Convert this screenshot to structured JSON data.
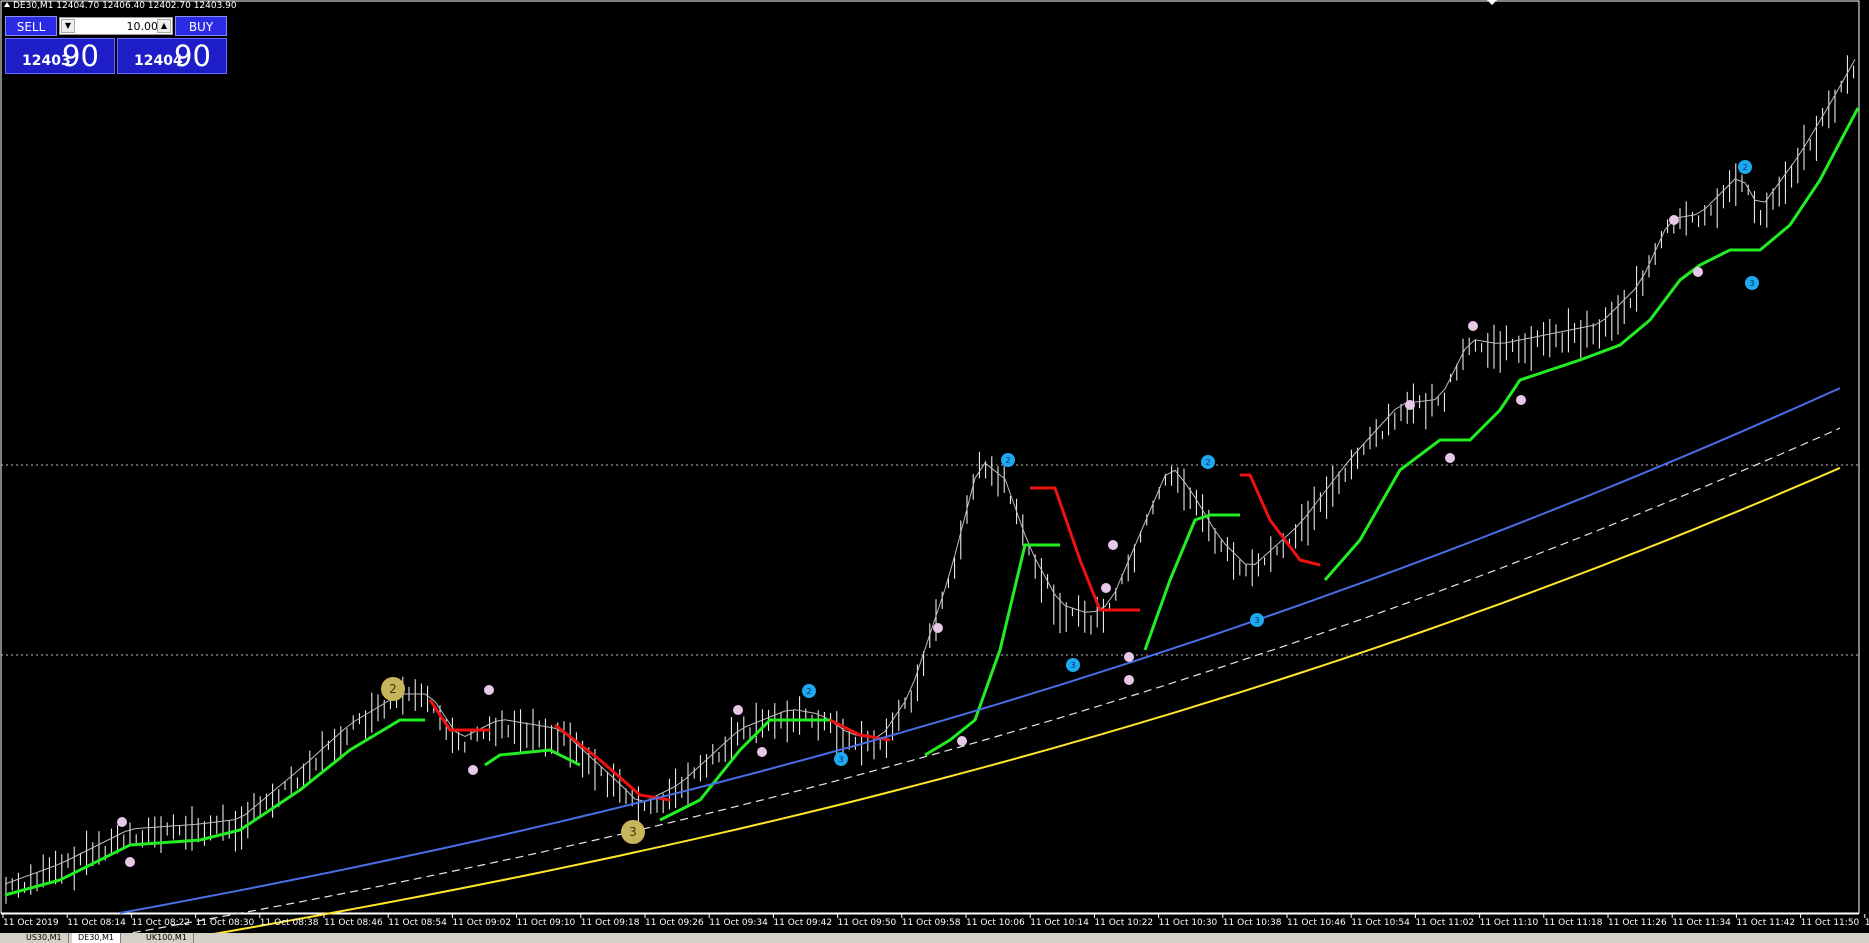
{
  "window": {
    "symbol_info": "DE30,M1  12404.70 12406.40 12402.70 12403.90"
  },
  "trade_panel": {
    "sell_label": "SELL",
    "buy_label": "BUY",
    "lot_value": "10.00",
    "bid_small": "12403",
    "bid_big": "90",
    "ask_small": "12404",
    "ask_big": "90",
    "button_color": "#2b2be4"
  },
  "tabs": [
    {
      "label": "US30,M1",
      "active": false
    },
    {
      "label": "DE30,M1",
      "active": true
    },
    {
      "label": "UK100,M1",
      "active": false
    }
  ],
  "colors": {
    "background": "#000000",
    "bars": "#ffffff",
    "trend_up": "#22ee22",
    "trend_down": "#ee1111",
    "ma_blue": "#4a6ee6",
    "ma_white_dashed": "#e6e6e6",
    "ma_yellow": "#ffe62a",
    "marker_pink": "#e8c8e8",
    "marker_cyan": "#1ea8ee",
    "marker_gold": "#c8b45a"
  },
  "time_axis": [
    "11 Oct 2019",
    "11 Oct 08:14",
    "11 Oct 08:22",
    "11 Oct 08:30",
    "11 Oct 08:38",
    "11 Oct 08:46",
    "11 Oct 08:54",
    "11 Oct 09:02",
    "11 Oct 09:10",
    "11 Oct 09:18",
    "11 Oct 09:26",
    "11 Oct 09:34",
    "11 Oct 09:42",
    "11 Oct 09:50",
    "11 Oct 09:58",
    "11 Oct 10:06",
    "11 Oct 10:14",
    "11 Oct 10:22",
    "11 Oct 10:30",
    "11 Oct 10:38",
    "11 Oct 10:46",
    "11 Oct 10:54",
    "11 Oct 11:02",
    "11 Oct 11:10",
    "11 Oct 11:18",
    "11 Oct 11:26",
    "11 Oct 11:34",
    "11 Oct 11:42",
    "11 Oct 11:50",
    "11"
  ],
  "markers": {
    "gold": [
      "2",
      "3"
    ],
    "cyan": [
      "2",
      "3",
      "2",
      "3",
      "2",
      "3",
      "2",
      "3"
    ]
  }
}
